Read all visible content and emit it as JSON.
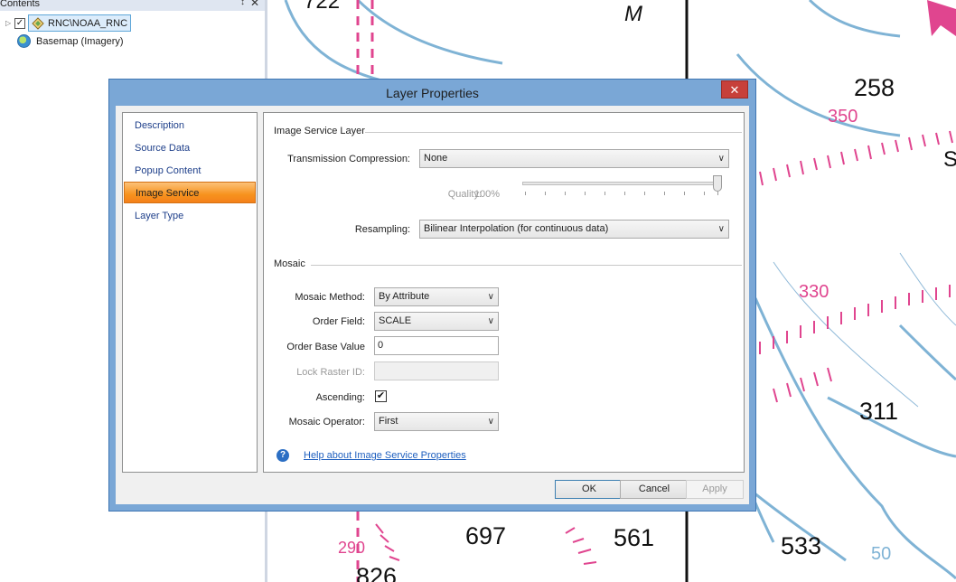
{
  "contents": {
    "title": "Contents",
    "pin_glyph": "↕",
    "close_glyph": "✕",
    "layers": [
      {
        "label": "RNC\\NOAA_RNC",
        "checked": true,
        "icon": "image-service-layer-icon"
      },
      {
        "label": "Basemap (Imagery)",
        "icon": "globe-icon"
      }
    ]
  },
  "map": {
    "depth_labels": [
      "722",
      "M",
      "258",
      "350",
      "S",
      "330",
      "311",
      "290",
      "697",
      "561",
      "533",
      "826",
      "50"
    ]
  },
  "dialog": {
    "title": "Layer Properties",
    "close_glyph": "✕",
    "nav_items": [
      "Description",
      "Source Data",
      "Popup Content",
      "Image Service",
      "Layer Type"
    ],
    "active_nav": "Image Service",
    "image_service_section": "Image Service Layer",
    "transmission_label": "Transmission Compression:",
    "transmission_value": "None",
    "quality_label": "Quality:",
    "quality_value": "100%",
    "resampling_label": "Resampling:",
    "resampling_value": "Bilinear Interpolation (for continuous data)",
    "mosaic_section": "Mosaic",
    "mosaic_method_label": "Mosaic Method:",
    "mosaic_method_value": "By Attribute",
    "order_field_label": "Order Field:",
    "order_field_value": "SCALE",
    "order_base_label": "Order Base Value",
    "order_base_value": "0",
    "lock_raster_label": "Lock Raster ID:",
    "lock_raster_value": "",
    "ascending_label": "Ascending:",
    "ascending_checked": true,
    "mosaic_operator_label": "Mosaic Operator:",
    "mosaic_operator_value": "First",
    "help_link": "Help about Image Service Properties",
    "help_glyph": "?",
    "check_glyph": "✔",
    "arrow_glyph": "∨",
    "buttons": {
      "ok": "OK",
      "cancel": "Cancel",
      "apply": "Apply"
    }
  },
  "colors": {
    "dialog_frame": "#7aa7d6",
    "active_nav": "#f7931e",
    "map_magenta": "#e0458f",
    "map_blue": "#7fb3d5"
  }
}
